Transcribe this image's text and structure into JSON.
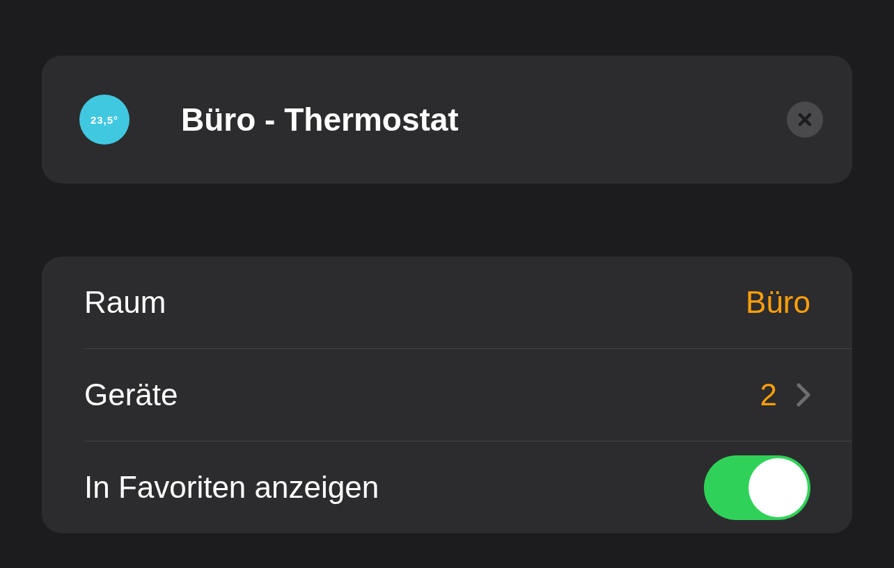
{
  "header": {
    "temperature": "23,5°",
    "title": "Büro - Thermostat"
  },
  "settings": [
    {
      "kind": "value",
      "label": "Raum",
      "value": "Büro"
    },
    {
      "kind": "link",
      "label": "Geräte",
      "value": "2"
    },
    {
      "kind": "toggle",
      "label": "In Favoriten anzeigen",
      "on": true
    }
  ]
}
